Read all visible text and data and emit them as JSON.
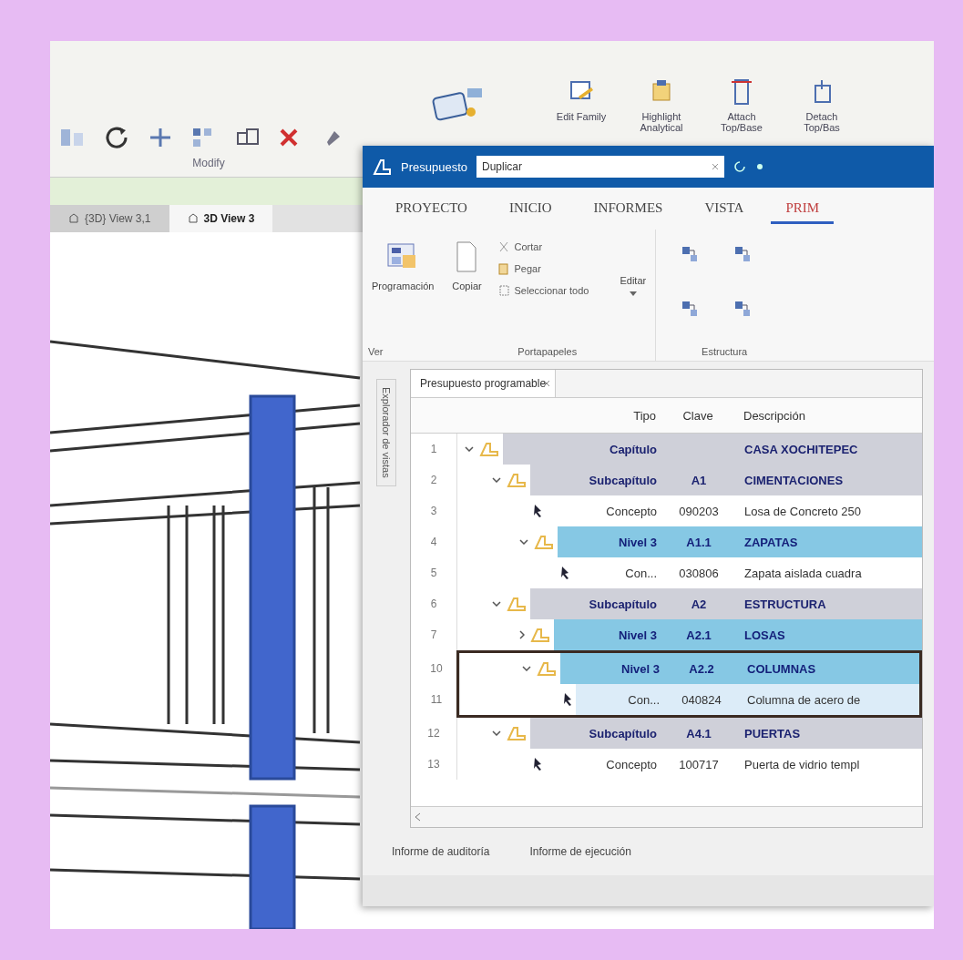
{
  "revit": {
    "ribbon_commands": [
      {
        "label": "Edit Family"
      },
      {
        "label": "Highlight Analytical"
      },
      {
        "label": "Attach Top/Base"
      },
      {
        "label": "Detach Top/Bas"
      }
    ],
    "panel_title": "Modify",
    "view_tabs": [
      {
        "label": "{3D} View 3,1",
        "selected": false
      },
      {
        "label": "3D View 3",
        "selected": true
      }
    ]
  },
  "presto": {
    "title": "Presupuesto",
    "search": {
      "value": "Duplicar"
    },
    "tabs": [
      {
        "label": "PROYECTO",
        "selected": false
      },
      {
        "label": "INICIO",
        "selected": false
      },
      {
        "label": "INFORMES",
        "selected": false
      },
      {
        "label": "VISTA",
        "selected": false
      },
      {
        "label": "PRIM",
        "selected": true
      }
    ],
    "ribbon": {
      "large_buttons": [
        "Programación",
        "Copiar"
      ],
      "small_buttons": [
        "Cortar",
        "Pegar",
        "Seleccionar todo"
      ],
      "menu_button": "Editar",
      "groups": [
        "Ver",
        "Portapapeles",
        "Estructura"
      ]
    },
    "document_tab": "Presupuesto programable",
    "side_panel": "Explorador de vistas",
    "table": {
      "columns": [
        "Tipo",
        "Clave",
        "Descripción"
      ],
      "rows": [
        {
          "number": "1",
          "kind": "chapter",
          "tipo": "Capítulo",
          "clave": "",
          "descripcion": "CASA XOCHITEPEC",
          "expanded": true,
          "children": [
            {
              "number": "2",
              "kind": "chapter",
              "tipo": "Subcapítulo",
              "clave": "A1",
              "descripcion": "CIMENTACIONES",
              "expanded": true,
              "children": [
                {
                  "number": "3",
                  "kind": "concept",
                  "tipo": "Concepto",
                  "clave": "090203",
                  "descripcion": "Losa de Concreto 250"
                },
                {
                  "number": "4",
                  "kind": "level",
                  "tipo": "Nivel 3",
                  "clave": "A1.1",
                  "descripcion": "ZAPATAS",
                  "expanded": true,
                  "children": [
                    {
                      "number": "5",
                      "kind": "concept",
                      "tipo": "Con...",
                      "clave": "030806",
                      "descripcion": "Zapata aislada cuadra"
                    }
                  ]
                }
              ]
            },
            {
              "number": "6",
              "kind": "chapter",
              "tipo": "Subcapítulo",
              "clave": "A2",
              "descripcion": "ESTRUCTURA",
              "expanded": true,
              "children": [
                {
                  "number": "7",
                  "kind": "level",
                  "tipo": "Nivel 3",
                  "clave": "A2.1",
                  "descripcion": "LOSAS",
                  "expanded": false
                },
                {
                  "number": "10",
                  "kind": "level",
                  "tipo": "Nivel 3",
                  "clave": "A2.2",
                  "descripcion": "COLUMNAS",
                  "expanded": true,
                  "framed": true,
                  "children": [
                    {
                      "number": "11",
                      "kind": "concept",
                      "tipo": "Con...",
                      "clave": "040824",
                      "descripcion": "Columna de acero de",
                      "selected": true
                    }
                  ]
                }
              ]
            },
            {
              "number": "12",
              "kind": "chapter",
              "tipo": "Subcapítulo",
              "clave": "A4.1",
              "descripcion": "PUERTAS",
              "expanded": true,
              "children": [
                {
                  "number": "13",
                  "kind": "concept",
                  "tipo": "Concepto",
                  "clave": "100717",
                  "descripcion": "Puerta de vidrio templ"
                }
              ]
            }
          ]
        }
      ]
    },
    "bottom_tabs": [
      {
        "label": "Informe de auditoría",
        "selected": false
      },
      {
        "label": "Informe de ejecución",
        "selected": false
      }
    ]
  }
}
